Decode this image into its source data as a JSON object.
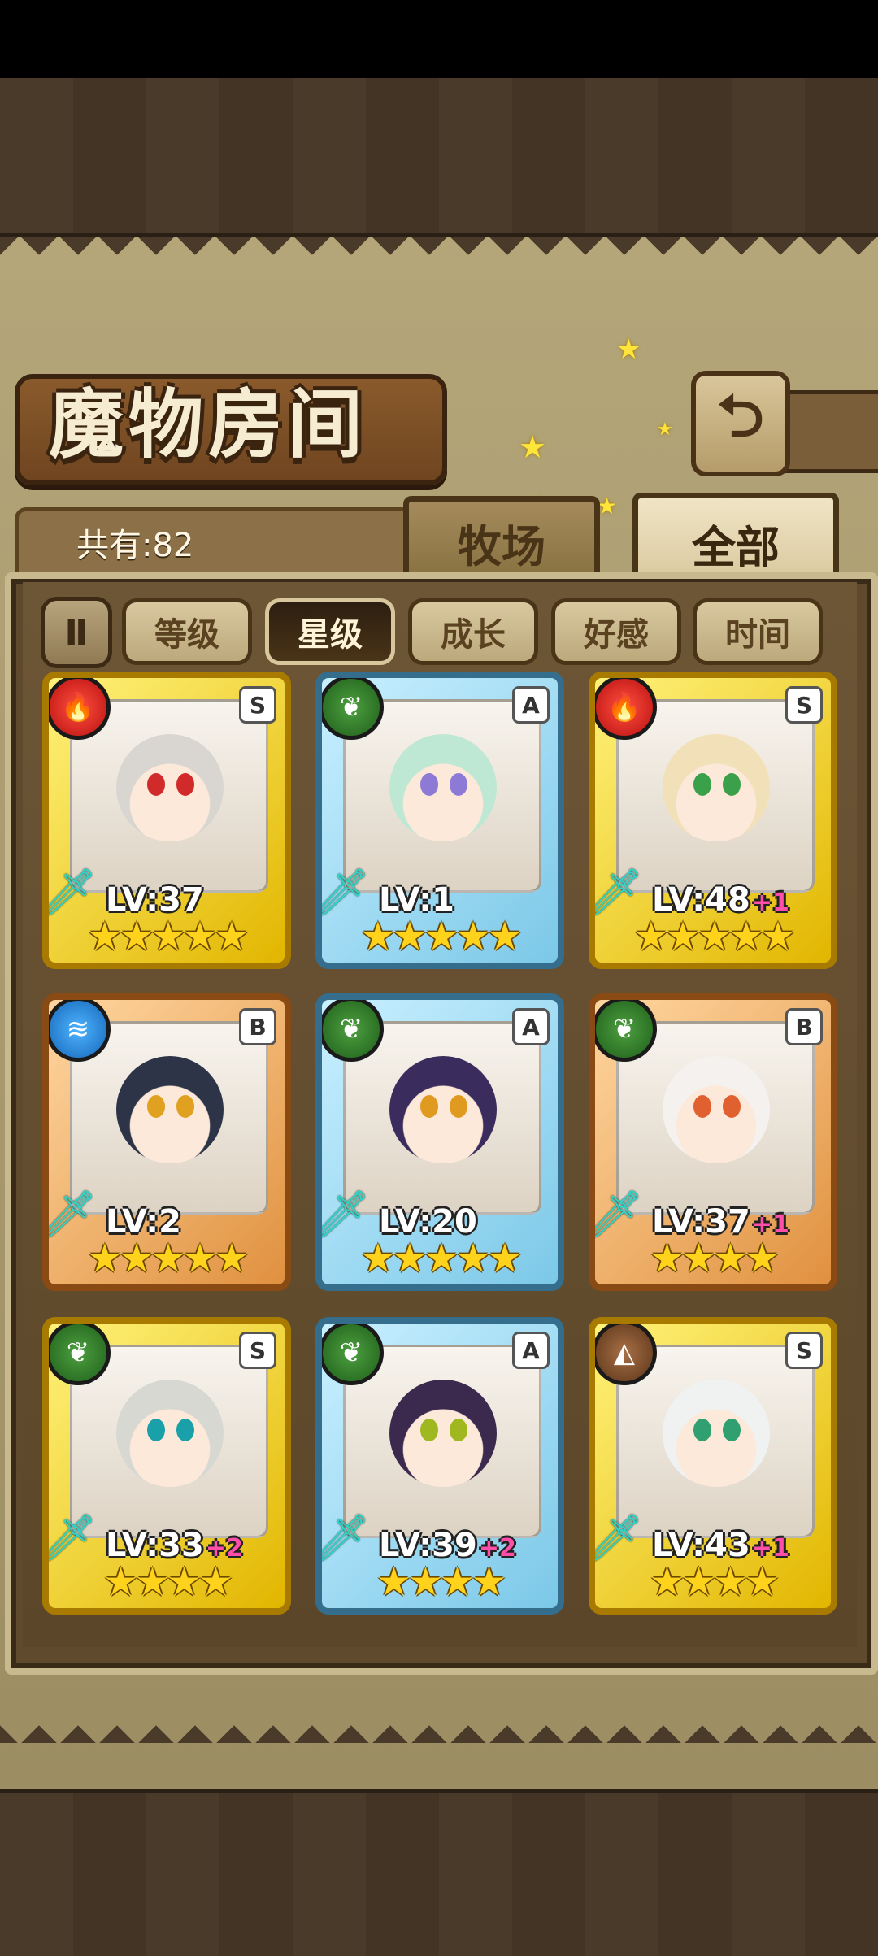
{
  "header": {
    "title": "魔物房间",
    "back_icon": "back-arrow-icon"
  },
  "tabs": [
    {
      "label": "牧场",
      "active": false
    },
    {
      "label": "全部",
      "active": true
    }
  ],
  "count_label": "共有:82",
  "sort": {
    "toggle_label": "Ⅱ",
    "options": [
      {
        "label": "等级",
        "active": false
      },
      {
        "label": "星级",
        "active": true
      },
      {
        "label": "成长",
        "active": false
      },
      {
        "label": "好感",
        "active": false
      },
      {
        "label": "时间",
        "active": false
      }
    ]
  },
  "cards": [
    {
      "rank": "S",
      "element": "fire",
      "element_icon": "fire-element-icon",
      "level": "LV:37",
      "bonus": "",
      "stars": 5,
      "hair": "#d9d6d2",
      "eyes": "#d02a2a"
    },
    {
      "rank": "A",
      "element": "nature",
      "element_icon": "leaf-element-icon",
      "level": "LV:1",
      "bonus": "",
      "stars": 5,
      "hair": "#bfe8d4",
      "eyes": "#8c7ad6"
    },
    {
      "rank": "S",
      "element": "fire",
      "element_icon": "fire-element-icon",
      "level": "LV:48",
      "bonus": "+1",
      "stars": 5,
      "hair": "#f2e1b8",
      "eyes": "#3aa04a"
    },
    {
      "rank": "B",
      "element": "water",
      "element_icon": "water-element-icon",
      "level": "LV:2",
      "bonus": "",
      "stars": 5,
      "hair": "#2e3448",
      "eyes": "#e0a020"
    },
    {
      "rank": "A",
      "element": "nature",
      "element_icon": "leaf-element-icon",
      "level": "LV:20",
      "bonus": "",
      "stars": 5,
      "hair": "#3a2c5c",
      "eyes": "#e09a20"
    },
    {
      "rank": "B",
      "element": "nature",
      "element_icon": "leaf-element-icon",
      "level": "LV:37",
      "bonus": "+1",
      "stars": 4,
      "hair": "#f4f1ee",
      "eyes": "#e06030"
    },
    {
      "rank": "S",
      "element": "nature",
      "element_icon": "leaf-element-icon",
      "level": "LV:33",
      "bonus": "+2",
      "stars": 4,
      "hair": "#d8d8d2",
      "eyes": "#1aa0a8"
    },
    {
      "rank": "A",
      "element": "nature",
      "element_icon": "leaf-element-icon",
      "level": "LV:39",
      "bonus": "+2",
      "stars": 4,
      "hair": "#3c2a4e",
      "eyes": "#a0b820"
    },
    {
      "rank": "S",
      "element": "earth",
      "element_icon": "earth-element-icon",
      "level": "LV:43",
      "bonus": "+1",
      "stars": 4,
      "hair": "#f0f2f2",
      "eyes": "#30a070"
    }
  ]
}
